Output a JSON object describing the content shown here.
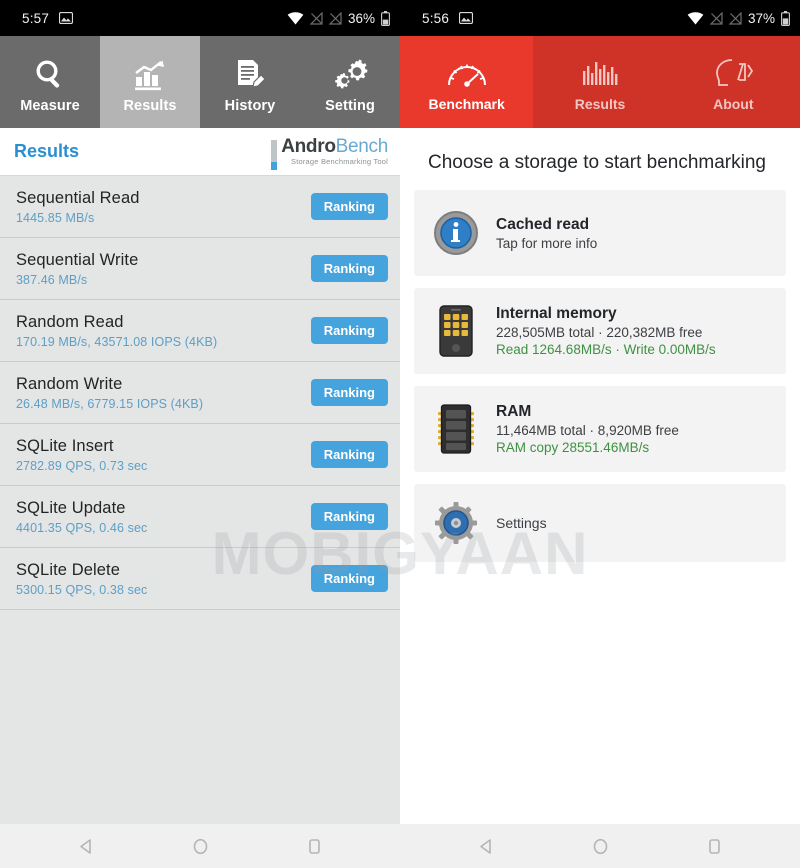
{
  "status_bars": [
    {
      "time": "5:57",
      "battery": "36%",
      "icons": [
        "image-icon",
        "wifi-icon",
        "signal-off-icon",
        "signal-off-icon",
        "battery-icon"
      ]
    },
    {
      "time": "5:56",
      "battery": "37%",
      "icons": [
        "image-icon",
        "wifi-icon",
        "signal-off-icon",
        "signal-off-icon",
        "battery-icon"
      ]
    }
  ],
  "left_app": {
    "tabs": [
      {
        "label": "Measure",
        "icon": "magnifier-icon",
        "active": false
      },
      {
        "label": "Results",
        "icon": "bar-chart-icon",
        "active": true
      },
      {
        "label": "History",
        "icon": "document-pencil-icon",
        "active": false
      },
      {
        "label": "Setting",
        "icon": "gears-icon",
        "active": false
      }
    ],
    "header": {
      "title": "Results",
      "logo_andro": "Andro",
      "logo_bench": "Bench",
      "logo_tagline": "Storage Benchmarking Tool"
    },
    "rows": [
      {
        "name": "Sequential Read",
        "value": "1445.85 MB/s",
        "button": "Ranking"
      },
      {
        "name": "Sequential Write",
        "value": "387.46 MB/s",
        "button": "Ranking"
      },
      {
        "name": "Random Read",
        "value": "170.19 MB/s, 43571.08 IOPS (4KB)",
        "button": "Ranking"
      },
      {
        "name": "Random Write",
        "value": "26.48 MB/s, 6779.15 IOPS (4KB)",
        "button": "Ranking"
      },
      {
        "name": "SQLite Insert",
        "value": "2782.89 QPS, 0.73 sec",
        "button": "Ranking"
      },
      {
        "name": "SQLite Update",
        "value": "4401.35 QPS, 0.46 sec",
        "button": "Ranking"
      },
      {
        "name": "SQLite Delete",
        "value": "5300.15 QPS, 0.38 sec",
        "button": "Ranking"
      }
    ]
  },
  "right_app": {
    "tabs": [
      {
        "label": "Benchmark",
        "icon": "speedometer-icon",
        "active": true
      },
      {
        "label": "Results",
        "icon": "equalizer-bars-icon",
        "active": false
      },
      {
        "label": "About",
        "icon": "head-code-icon",
        "active": false
      }
    ],
    "title": "Choose a storage to start benchmarking",
    "cards": [
      {
        "icon": "info-icon",
        "title": "Cached read",
        "subtitle": "Tap for more info",
        "speed": ""
      },
      {
        "icon": "phone-icon",
        "title": "Internal memory",
        "subtitle": "228,505MB total · 220,382MB free",
        "speed": "Read 1264.68MB/s · Write 0.00MB/s"
      },
      {
        "icon": "ram-chip-icon",
        "title": "RAM",
        "subtitle": "11,464MB total · 8,920MB free",
        "speed": "RAM copy 28551.46MB/s"
      },
      {
        "icon": "gear-icon",
        "title": "Settings",
        "subtitle": "",
        "speed": ""
      }
    ]
  },
  "watermark": "MOBIGYAAN",
  "nav_bars": [
    {
      "back": "back-triangle-icon",
      "home": "home-circle-icon",
      "recents": "recents-square-icon"
    },
    {
      "back": "back-triangle-icon",
      "home": "home-circle-icon",
      "recents": "recents-square-icon"
    }
  ],
  "colors": {
    "androbench_accent": "#45a3de",
    "androbench_tab_active": "#b4b4b4",
    "androbench_tab_inactive": "#6b6b6b",
    "a1sd_red": "#cf3327",
    "a1sd_red_active": "#e8392c",
    "green_speed": "#3f9142",
    "panel_left_bg": "#e4e5e5"
  }
}
